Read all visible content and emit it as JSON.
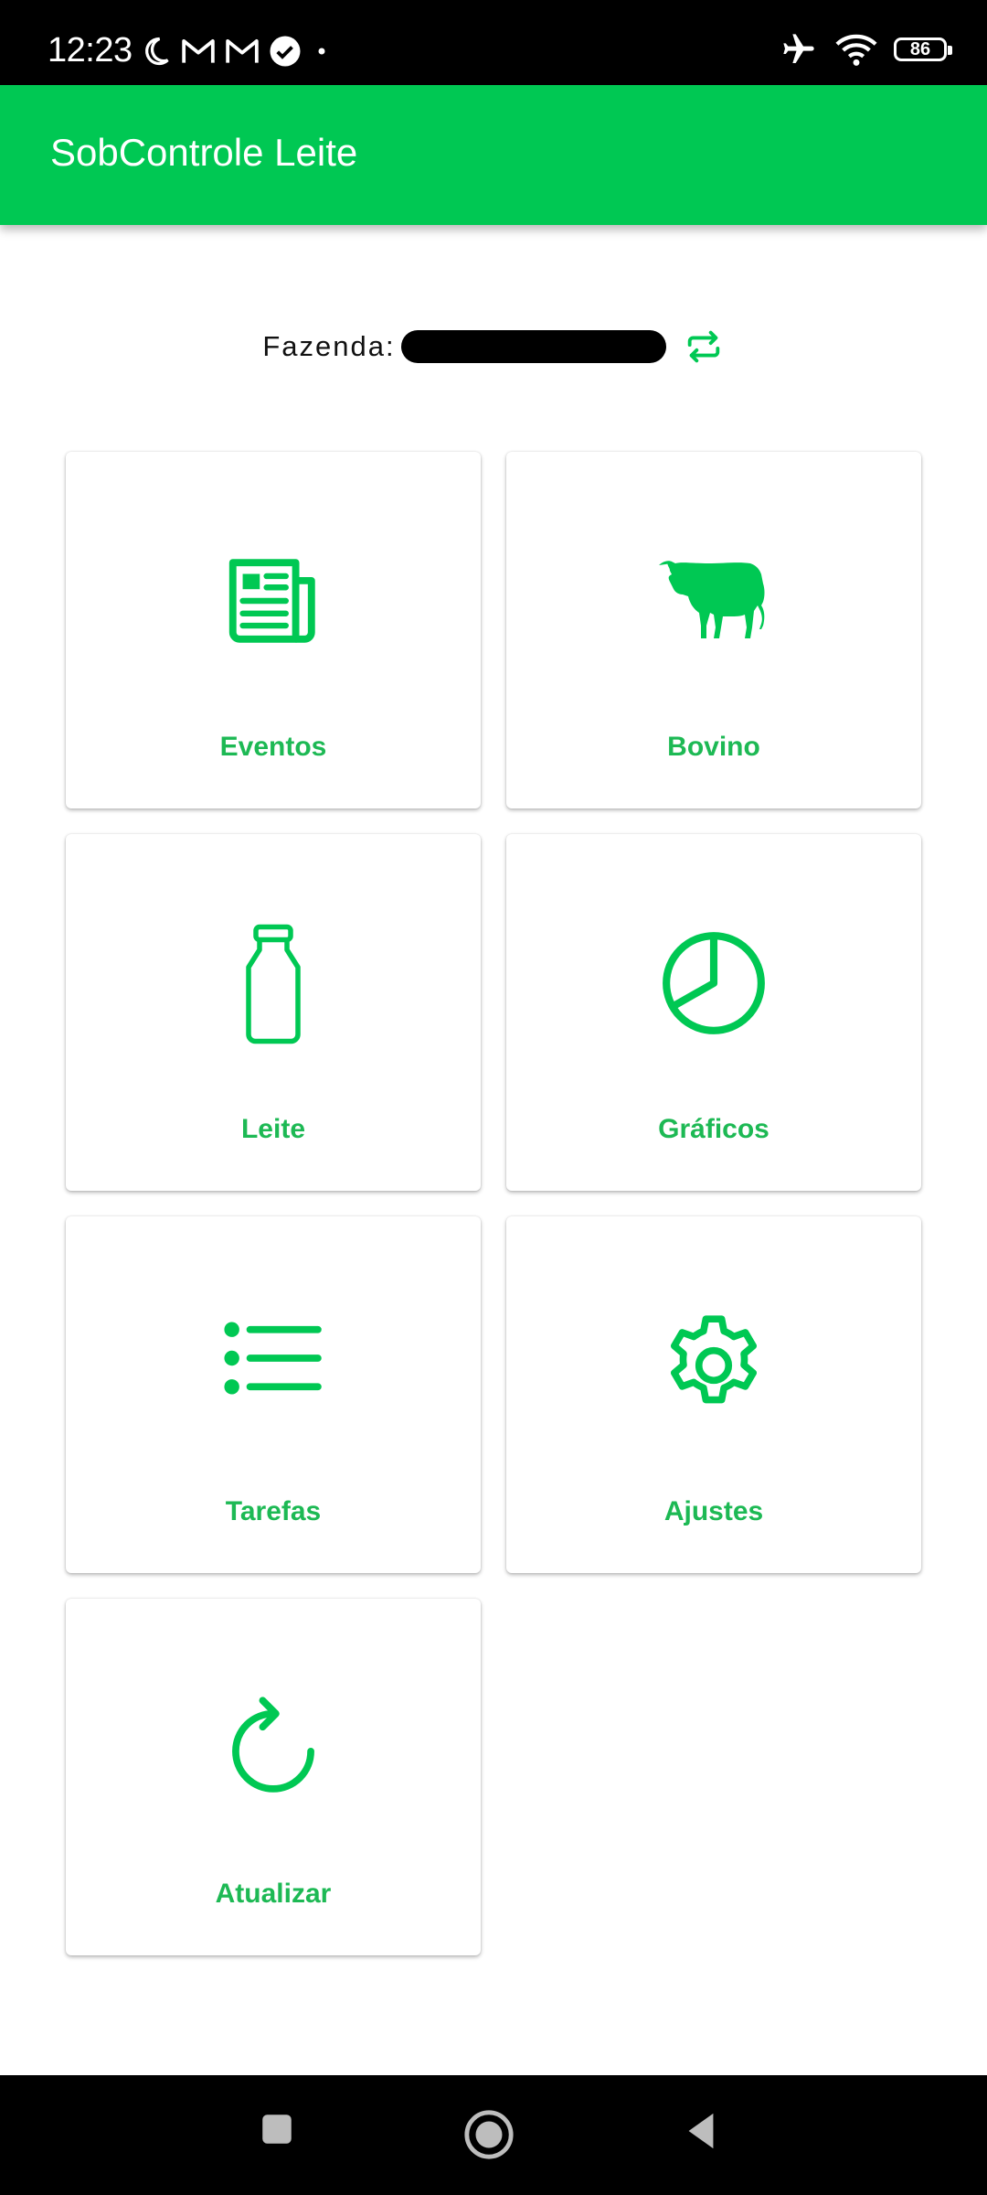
{
  "status_bar": {
    "time": "12:23",
    "battery": "86",
    "left_icons": [
      "moon-icon",
      "gmail-icon",
      "gmail-icon",
      "check-circle-icon",
      "dot-icon"
    ],
    "right_icons": [
      "airplane-icon",
      "wifi-icon",
      "battery-icon"
    ]
  },
  "app_bar": {
    "title": "SobControle Leite"
  },
  "farm": {
    "label": "Fazenda:",
    "name": ""
  },
  "tiles": [
    {
      "label": "Eventos",
      "icon": "newspaper-icon"
    },
    {
      "label": "Bovino",
      "icon": "cow-icon"
    },
    {
      "label": "Leite",
      "icon": "milk-bottle-icon"
    },
    {
      "label": "Gráficos",
      "icon": "pie-chart-icon"
    },
    {
      "label": "Tarefas",
      "icon": "list-icon"
    },
    {
      "label": "Ajustes",
      "icon": "gear-icon"
    },
    {
      "label": "Atualizar",
      "icon": "refresh-icon"
    }
  ],
  "colors": {
    "accent": "#00c853",
    "label": "#1db954",
    "text": "#111111"
  }
}
